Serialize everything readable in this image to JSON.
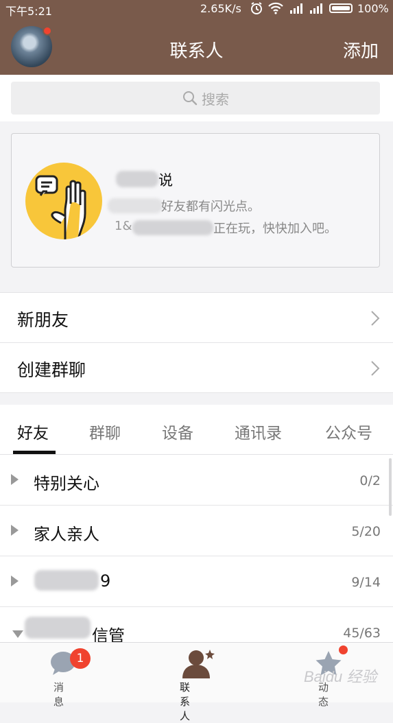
{
  "status_bar": {
    "time": "下午5:21",
    "speed": "2.65K/s",
    "battery": "100%"
  },
  "header": {
    "title": "联系人",
    "add_label": "添加",
    "avatar_has_notification": true
  },
  "search": {
    "placeholder": "搜索"
  },
  "promo": {
    "title_visible": "说",
    "line1_visible": "好友都有闪光点。",
    "line2_prefix": "1&",
    "line2_visible": "正在玩，快快加入吧。"
  },
  "nav_rows": [
    {
      "label": "新朋友"
    },
    {
      "label": "创建群聊"
    }
  ],
  "tabs": [
    {
      "label": "好友",
      "active": true
    },
    {
      "label": "群聊",
      "active": false
    },
    {
      "label": "设备",
      "active": false
    },
    {
      "label": "通讯录",
      "active": false
    },
    {
      "label": "公众号",
      "active": false
    }
  ],
  "groups": [
    {
      "name": "特别关心",
      "count": "0/2",
      "expanded": false
    },
    {
      "name": "家人亲人",
      "count": "5/20",
      "expanded": false
    },
    {
      "name": "9",
      "count": "9/14",
      "expanded": false
    },
    {
      "name": "信管",
      "count": "45/63",
      "expanded": true
    }
  ],
  "bottom_tabs": [
    {
      "label": "消息",
      "badge": "1"
    },
    {
      "label": "联系人",
      "active": true
    },
    {
      "label": "动态",
      "dot": true
    }
  ],
  "watermark": "Baidu 经验",
  "colors": {
    "header_bg": "#795a4b",
    "badge_red": "#f0432f",
    "promo_icon_yellow": "#f8c63a"
  }
}
